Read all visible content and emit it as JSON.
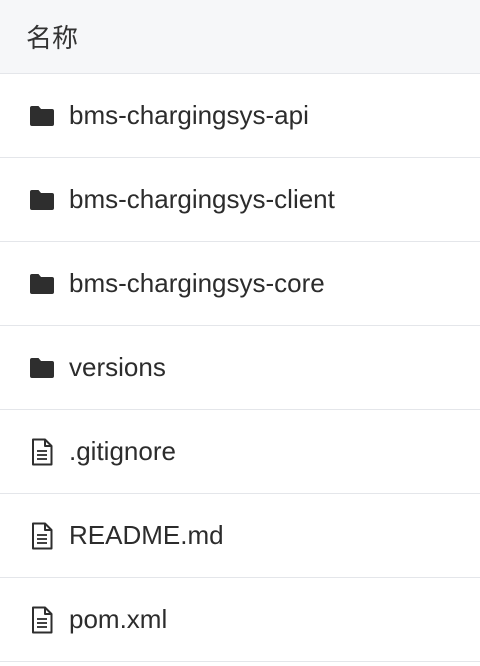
{
  "header": {
    "name_column": "名称"
  },
  "files": [
    {
      "name": "bms-chargingsys-api",
      "type": "folder",
      "icon": "folder-icon"
    },
    {
      "name": "bms-chargingsys-client",
      "type": "folder",
      "icon": "folder-icon"
    },
    {
      "name": "bms-chargingsys-core",
      "type": "folder",
      "icon": "folder-icon"
    },
    {
      "name": "versions",
      "type": "folder",
      "icon": "folder-icon"
    },
    {
      "name": ".gitignore",
      "type": "file",
      "icon": "file-icon"
    },
    {
      "name": "README.md",
      "type": "file",
      "icon": "file-icon"
    },
    {
      "name": "pom.xml",
      "type": "file",
      "icon": "file-icon"
    }
  ]
}
